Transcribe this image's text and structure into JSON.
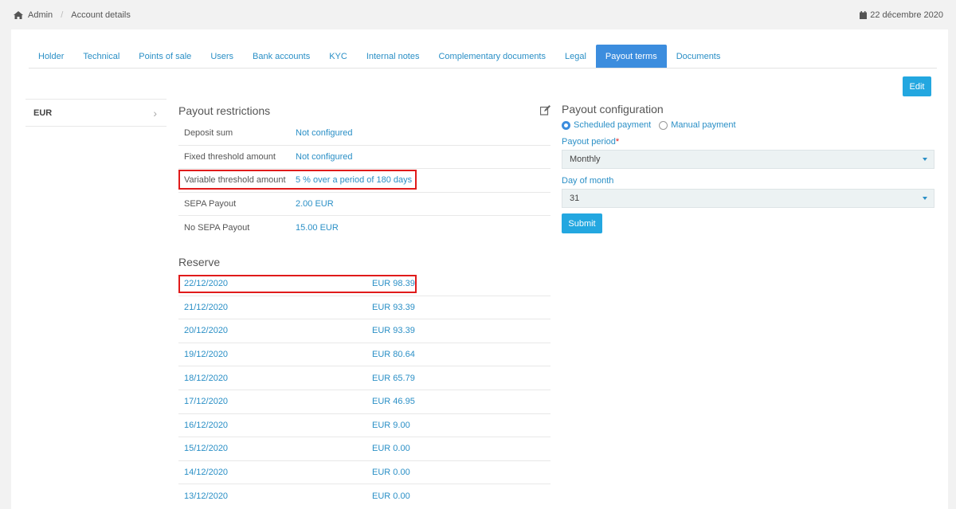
{
  "breadcrumb": {
    "home": "Admin",
    "current": "Account details"
  },
  "date": "22 décembre 2020",
  "tabs": [
    {
      "label": "Holder"
    },
    {
      "label": "Technical"
    },
    {
      "label": "Points of sale"
    },
    {
      "label": "Users"
    },
    {
      "label": "Bank accounts"
    },
    {
      "label": "KYC"
    },
    {
      "label": "Internal notes"
    },
    {
      "label": "Complementary documents"
    },
    {
      "label": "Legal"
    },
    {
      "label": "Payout terms",
      "active": true
    },
    {
      "label": "Documents"
    }
  ],
  "edit_label": "Edit",
  "currencies": [
    {
      "label": "EUR"
    }
  ],
  "restrictions": {
    "title": "Payout restrictions",
    "rows": [
      {
        "label": "Deposit sum",
        "value": "Not configured"
      },
      {
        "label": "Fixed threshold amount",
        "value": "Not configured"
      },
      {
        "label": "Variable threshold amount",
        "value": "5 % over a period of 180 days"
      },
      {
        "label": "SEPA Payout",
        "value": "2.00 EUR"
      },
      {
        "label": "No SEPA Payout",
        "value": "15.00 EUR"
      }
    ]
  },
  "reserve": {
    "title": "Reserve",
    "rows": [
      {
        "date": "22/12/2020",
        "amount": "EUR 98.39"
      },
      {
        "date": "21/12/2020",
        "amount": "EUR 93.39"
      },
      {
        "date": "20/12/2020",
        "amount": "EUR 93.39"
      },
      {
        "date": "19/12/2020",
        "amount": "EUR 80.64"
      },
      {
        "date": "18/12/2020",
        "amount": "EUR 65.79"
      },
      {
        "date": "17/12/2020",
        "amount": "EUR 46.95"
      },
      {
        "date": "16/12/2020",
        "amount": "EUR 9.00"
      },
      {
        "date": "15/12/2020",
        "amount": "EUR 0.00"
      },
      {
        "date": "14/12/2020",
        "amount": "EUR 0.00"
      },
      {
        "date": "13/12/2020",
        "amount": "EUR 0.00"
      }
    ]
  },
  "config": {
    "title": "Payout configuration",
    "scheduled_label": "Scheduled payment",
    "manual_label": "Manual payment",
    "selected_mode": "scheduled",
    "period_label": "Payout period",
    "period_required": "*",
    "period_value": "Monthly",
    "day_label": "Day of month",
    "day_value": "31",
    "submit_label": "Submit"
  },
  "colors": {
    "accent": "#3c8dde",
    "link": "#2a8fc6",
    "button": "#23a7e0",
    "highlight": "#e01b1b"
  },
  "icons": {
    "home": "home-icon",
    "calendar": "calendar-icon",
    "edit": "edit-icon",
    "chevron": "chevron-right-icon"
  }
}
